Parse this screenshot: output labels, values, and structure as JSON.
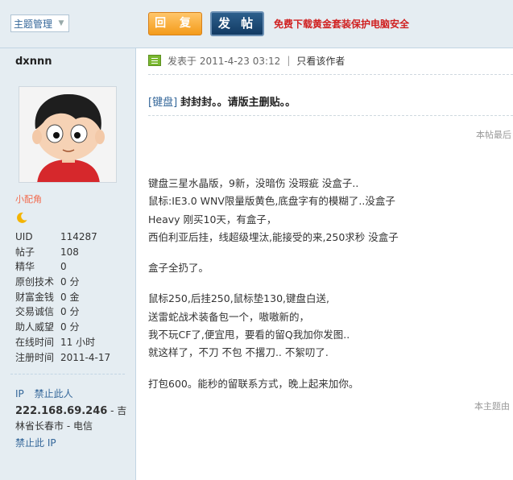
{
  "toolbar": {
    "theme_manage": "主题管理",
    "reply_label": "回 复",
    "post_label": "发 帖",
    "promo_text": "免费下载黄金套装保护电脑安全"
  },
  "user": {
    "name": "dxnnn",
    "rank": "小配角",
    "stats": [
      {
        "k": "UID",
        "v": "114287"
      },
      {
        "k": "帖子",
        "v": "108"
      },
      {
        "k": "精华",
        "v": "0"
      },
      {
        "k": "原创技术",
        "v": "0 分"
      },
      {
        "k": "财富金钱",
        "v": "0 金"
      },
      {
        "k": "交易诚信",
        "v": "0 分"
      },
      {
        "k": "助人威望",
        "v": "0 分"
      },
      {
        "k": "在线时间",
        "v": "11 小时"
      },
      {
        "k": "注册时间",
        "v": "2011-4-17"
      }
    ],
    "ip_link": "IP",
    "ban_user": "禁止此人",
    "ip_address": "222.168.69.246",
    "ip_location": " - 吉林省长春市 - 电信",
    "ban_ip": "禁止此 IP"
  },
  "post": {
    "posted_at": "发表于 2011-4-23 03:12",
    "separator": "|",
    "only_author": "只看该作者",
    "category": "[键盘]",
    "title": "封封封。。请版主删贴。。",
    "newest_note": "本帖最后",
    "lines": [
      "键盘三星水晶版，9新，没暗伤 没瑕疵 没盒子..",
      "鼠标:IE3.0 WNV限量版黄色,底盘字有的模糊了..没盒子",
      "Heavy 刚买10天，有盒子，",
      "西伯利亚后挂，线超级埋汰,能接受的来,250求秒 没盒子",
      "",
      "盒子全扔了。",
      "",
      "鼠标250,后挂250,鼠标垫130,键盘白送,",
      "送雷蛇战术装备包一个，嗷嗷新的，",
      "我不玩CF了,便宜甩，要看的留Q我加你发图..",
      "就这样了，不刀 不包 不撂刀.. 不絮叨了.",
      "",
      "打包600。能秒的留联系方式，晚上起来加你。"
    ],
    "last_reply": "本主题由"
  },
  "colors": {
    "sidebar_bg": "#e5edf2",
    "link": "#336699",
    "promo": "#d02020",
    "rank": "#f26c4f"
  }
}
